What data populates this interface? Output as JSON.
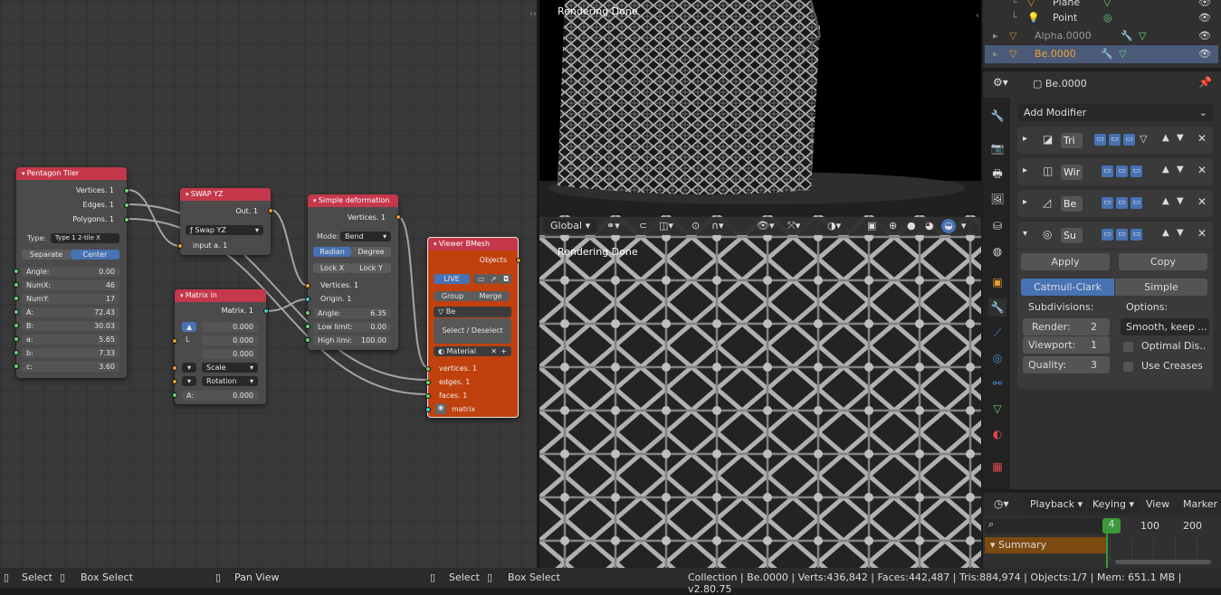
{
  "node_editor": {
    "nodes": {
      "pentagon_tiler": {
        "title": "Pentagon Tiler",
        "outputs": [
          "Vertices. 1",
          "Edges. 1",
          "Polygons. 1"
        ],
        "type_label": "Type:",
        "type_value": "Type 1 2-tile X",
        "separate": "Separate",
        "center": "Center",
        "fields": [
          {
            "label": "Angle:",
            "value": "0.00"
          },
          {
            "label": "NumX:",
            "value": "46"
          },
          {
            "label": "NumY:",
            "value": "17"
          },
          {
            "label": "A:",
            "value": "72.43"
          },
          {
            "label": "B:",
            "value": "30.03"
          },
          {
            "label": "a:",
            "value": "5.65"
          },
          {
            "label": "b:",
            "value": "7.33"
          },
          {
            "label": "c:",
            "value": "3.60"
          }
        ]
      },
      "swap_yz": {
        "title": "SWAP YZ",
        "output": "Out. 1",
        "dropdown": "Swap YZ",
        "input": "input a. 1"
      },
      "matrix_in": {
        "title": "Matrix in",
        "output": "Matrix. 1",
        "loc_values": [
          "0.000",
          "0.000",
          "0.000"
        ],
        "loc_letter": "L",
        "scale": "Scale",
        "rotation": "Rotation",
        "angle_label": "A:",
        "angle_value": "0.000"
      },
      "simple_deformation": {
        "title": "Simple deformation",
        "output": "Vertices. 1",
        "mode_label": "Mode:",
        "mode_value": "Bend",
        "radian": "Radian",
        "degree": "Degree",
        "lock_x": "Lock X",
        "lock_y": "Lock Y",
        "inputs": [
          "Vertices. 1",
          "Origin. 1"
        ],
        "angle_label": "Angle:",
        "angle_value": "6.35",
        "low_label": "Low limit:",
        "low_value": "0.00",
        "high_label": "High limi:",
        "high_value": "100.00"
      },
      "viewer_bmesh": {
        "title": "Viewer BMesh",
        "objects": "Objects",
        "live": "LIVE",
        "group": "Group",
        "merge": "Merge",
        "object_name": "Be",
        "select_deselect": "Select / Deselect",
        "material": "Material",
        "inputs": [
          "vertices. 1",
          "edges. 1",
          "faces. 1",
          "matrix"
        ]
      }
    }
  },
  "viewport_top": {
    "status": "Rendering Done"
  },
  "viewport_bottom": {
    "status": "Rendering Done"
  },
  "viewport_toolbar": {
    "orientation": "Global"
  },
  "outliner": {
    "items": [
      {
        "label": "Plane"
      },
      {
        "label": "Point"
      },
      {
        "label": "Alpha.0000"
      },
      {
        "label": "Be.0000"
      }
    ]
  },
  "properties": {
    "object_name": "Be.0000",
    "add_modifier": "Add Modifier",
    "modifiers": [
      {
        "name": "Tri"
      },
      {
        "name": "Wir"
      },
      {
        "name": "Be"
      },
      {
        "name": "Su"
      }
    ],
    "apply": "Apply",
    "copy": "Copy",
    "catmull_clark": "Catmull-Clark",
    "simple": "Simple",
    "subdivisions_label": "Subdivisions:",
    "options_label": "Options:",
    "render_label": "Render:",
    "render_value": "2",
    "viewport_label": "Viewport:",
    "viewport_value": "1",
    "quality_label": "Quality:",
    "quality_value": "3",
    "smooth_option": "Smooth, keep ...",
    "optimal_display": "Optimal Dis..",
    "use_creases": "Use Creases"
  },
  "timeline": {
    "playback": "Playback",
    "keying": "Keying",
    "view": "View",
    "marker": "Marker",
    "current_frame": "4",
    "ticks": [
      "100",
      "200"
    ],
    "summary": "Summary"
  },
  "statusbar": {
    "select": "Select",
    "box_select": "Box Select",
    "pan_view": "Pan View",
    "select2": "Select",
    "box_select2": "Box Select",
    "stats": "Collection | Be.0000 | Verts:436,842 | Faces:442,487 | Tris:884,974 | Objects:1/7 | Mem: 651.1 MB | v2.80.75"
  },
  "colors": {
    "node_header": "#c5374a",
    "viewer_node": "#c0410d",
    "accent_blue": "#4772b3",
    "selected_outliner": "#f0a030",
    "timeline_frame": "#3a9a3a",
    "summary_bg": "#7a4a10"
  }
}
